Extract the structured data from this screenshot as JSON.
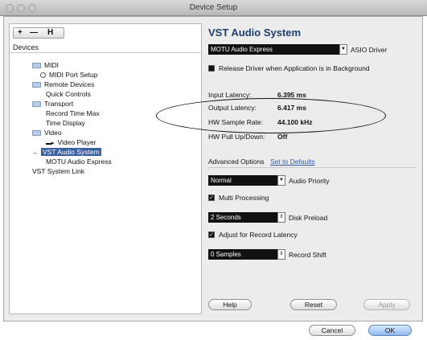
{
  "window": {
    "title": "Device Setup"
  },
  "left_panel": {
    "toolbar": {
      "add_label": "+",
      "remove_label": "—",
      "reset_label": "H"
    },
    "devices_label": "Devices",
    "tree": [
      {
        "label": "MIDI",
        "type": "folder"
      },
      {
        "label": "MIDI Port Setup",
        "type": "radio"
      },
      {
        "label": "Remote Devices",
        "type": "folder"
      },
      {
        "label": "Quick Controls",
        "type": "child"
      },
      {
        "label": "Transport",
        "type": "folder"
      },
      {
        "label": "Record Time Max",
        "type": "child"
      },
      {
        "label": "Time Display",
        "type": "child"
      },
      {
        "label": "Video",
        "type": "folder"
      },
      {
        "label": "Video Player",
        "type": "plug"
      },
      {
        "label": "VST Audio System",
        "type": "selected"
      },
      {
        "label": "MOTU Audio Express",
        "type": "child"
      },
      {
        "label": "VST System Link",
        "type": "root"
      }
    ]
  },
  "right_panel": {
    "title": "VST Audio System",
    "driver": {
      "value": "MOTU Audio Express",
      "label": "ASIO Driver"
    },
    "release_driver_label": "Release Driver when Application is in Background",
    "info": {
      "input_latency_label": "Input Latency:",
      "input_latency_value": "6.395 ms",
      "output_latency_label": "Output Latency:",
      "output_latency_value": "6.417 ms",
      "sample_rate_label": "HW Sample Rate:",
      "sample_rate_value": "44.100 kHz",
      "pull_label": "HW Pull Up/Down:",
      "pull_value": "Off"
    },
    "advanced_options_label": "Advanced Options",
    "set_to_defaults_label": "Set to Defaults",
    "audio_priority": {
      "value": "Normal",
      "label": "Audio Priority"
    },
    "multi_processing_label": "Multi Processing",
    "disk_preload": {
      "value": "2 Seconds",
      "label": "Disk Preload"
    },
    "adjust_latency_label": "Adjust for Record Latency",
    "record_shift": {
      "value": "0 Samples",
      "label": "Record Shift"
    },
    "help_label": "Help",
    "reset_label": "Reset",
    "apply_label": "Apply"
  },
  "dialog_buttons": {
    "cancel_label": "Cancel",
    "ok_label": "OK"
  },
  "colors": {
    "title_blue": "#1f3d6d",
    "selection_blue": "#3a5f9f"
  }
}
